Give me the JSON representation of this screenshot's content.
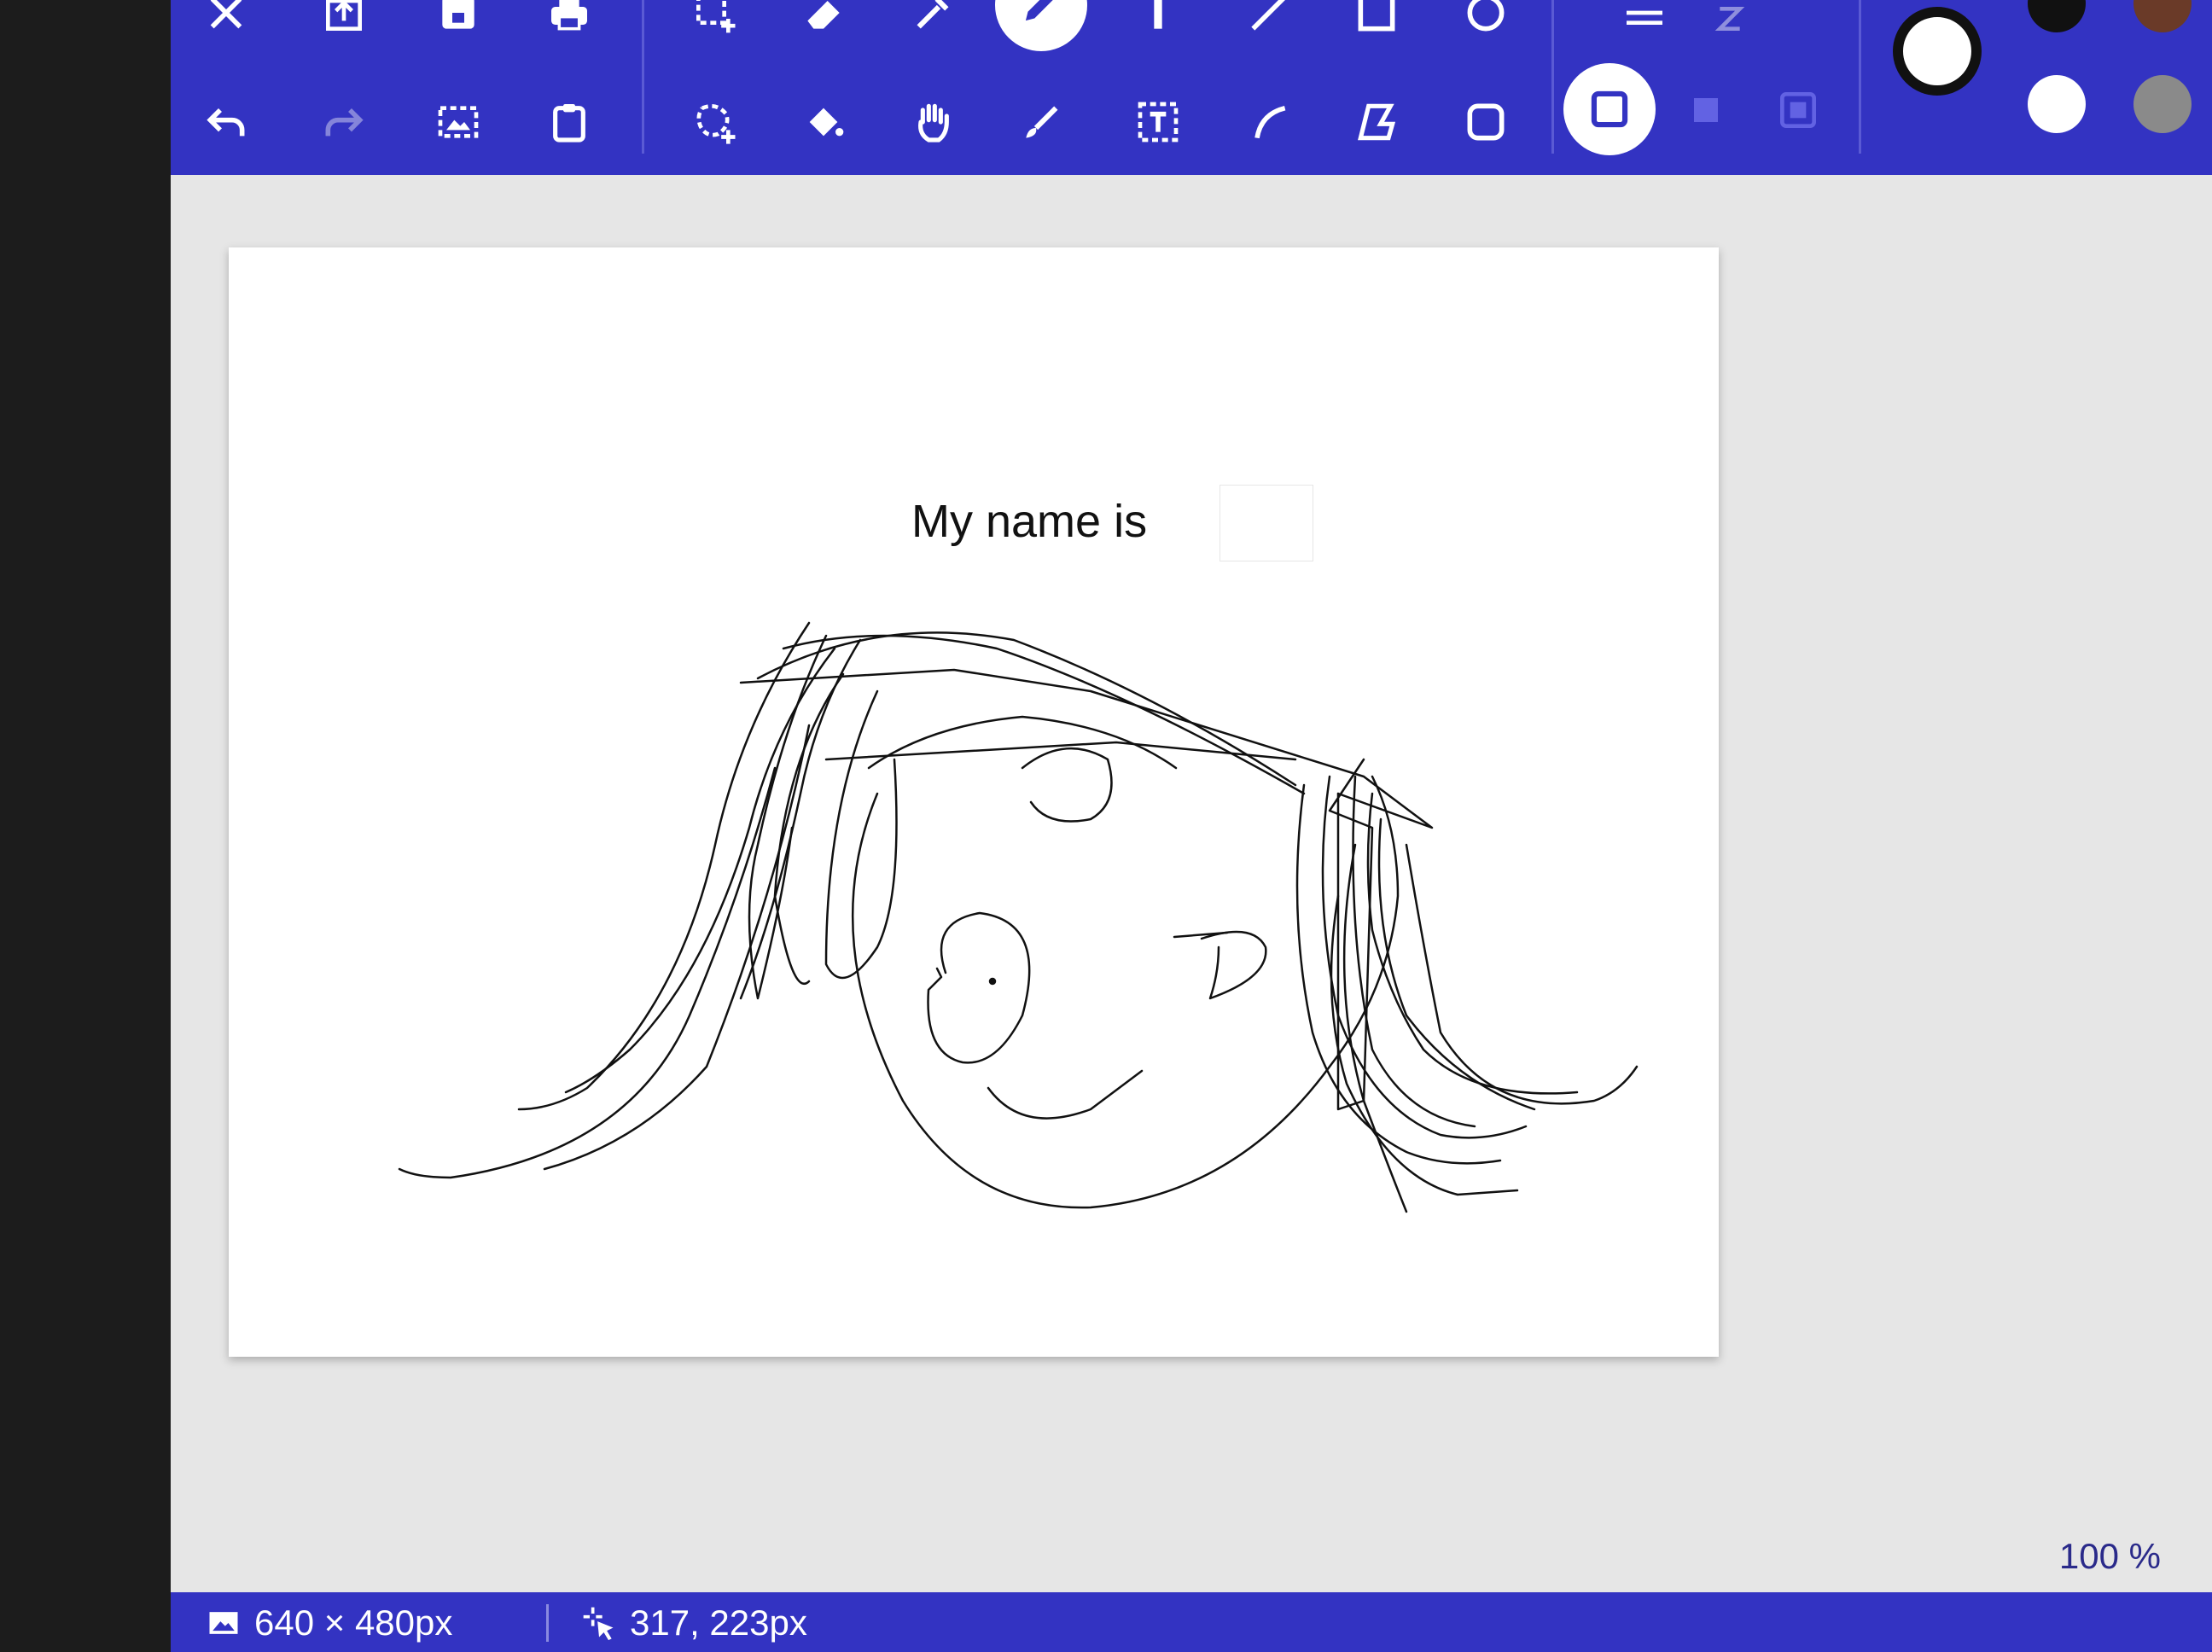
{
  "app": {
    "accent_color": "#3333c2"
  },
  "toolbar": {
    "row1": [
      {
        "name": "close-icon"
      },
      {
        "name": "export-icon"
      },
      {
        "name": "save-icon"
      },
      {
        "name": "print-icon"
      },
      {
        "name": "select-add-icon"
      },
      {
        "name": "eraser-icon"
      },
      {
        "name": "color-picker-icon"
      },
      {
        "name": "pencil-icon",
        "active": true
      },
      {
        "name": "line-icon"
      },
      {
        "name": "rectangle-icon"
      },
      {
        "name": "ellipse-icon"
      },
      {
        "name": "line-width-icon"
      }
    ],
    "row2": [
      {
        "name": "undo-icon"
      },
      {
        "name": "redo-icon"
      },
      {
        "name": "image-select-icon"
      },
      {
        "name": "clipboard-icon"
      },
      {
        "name": "free-select-icon"
      },
      {
        "name": "fill-bucket-icon"
      },
      {
        "name": "hand-pan-icon"
      },
      {
        "name": "brush-icon"
      },
      {
        "name": "text-tool-icon"
      },
      {
        "name": "curve-icon"
      },
      {
        "name": "polygon-icon"
      },
      {
        "name": "rounded-rect-icon"
      },
      {
        "name": "outline-shape-icon",
        "active": true
      },
      {
        "name": "filled-shape-icon"
      },
      {
        "name": "outline-filled-shape-icon"
      }
    ],
    "colors": {
      "primary": "#ffffff",
      "palette": [
        "#111111",
        "#6a3a28",
        "#ffffff",
        "#8a8a8a"
      ]
    }
  },
  "canvas": {
    "text": "My name is",
    "background": "#ffffff"
  },
  "status": {
    "image_size": "640 × 480px",
    "cursor_position": "317, 223px",
    "zoom": "100 %"
  }
}
